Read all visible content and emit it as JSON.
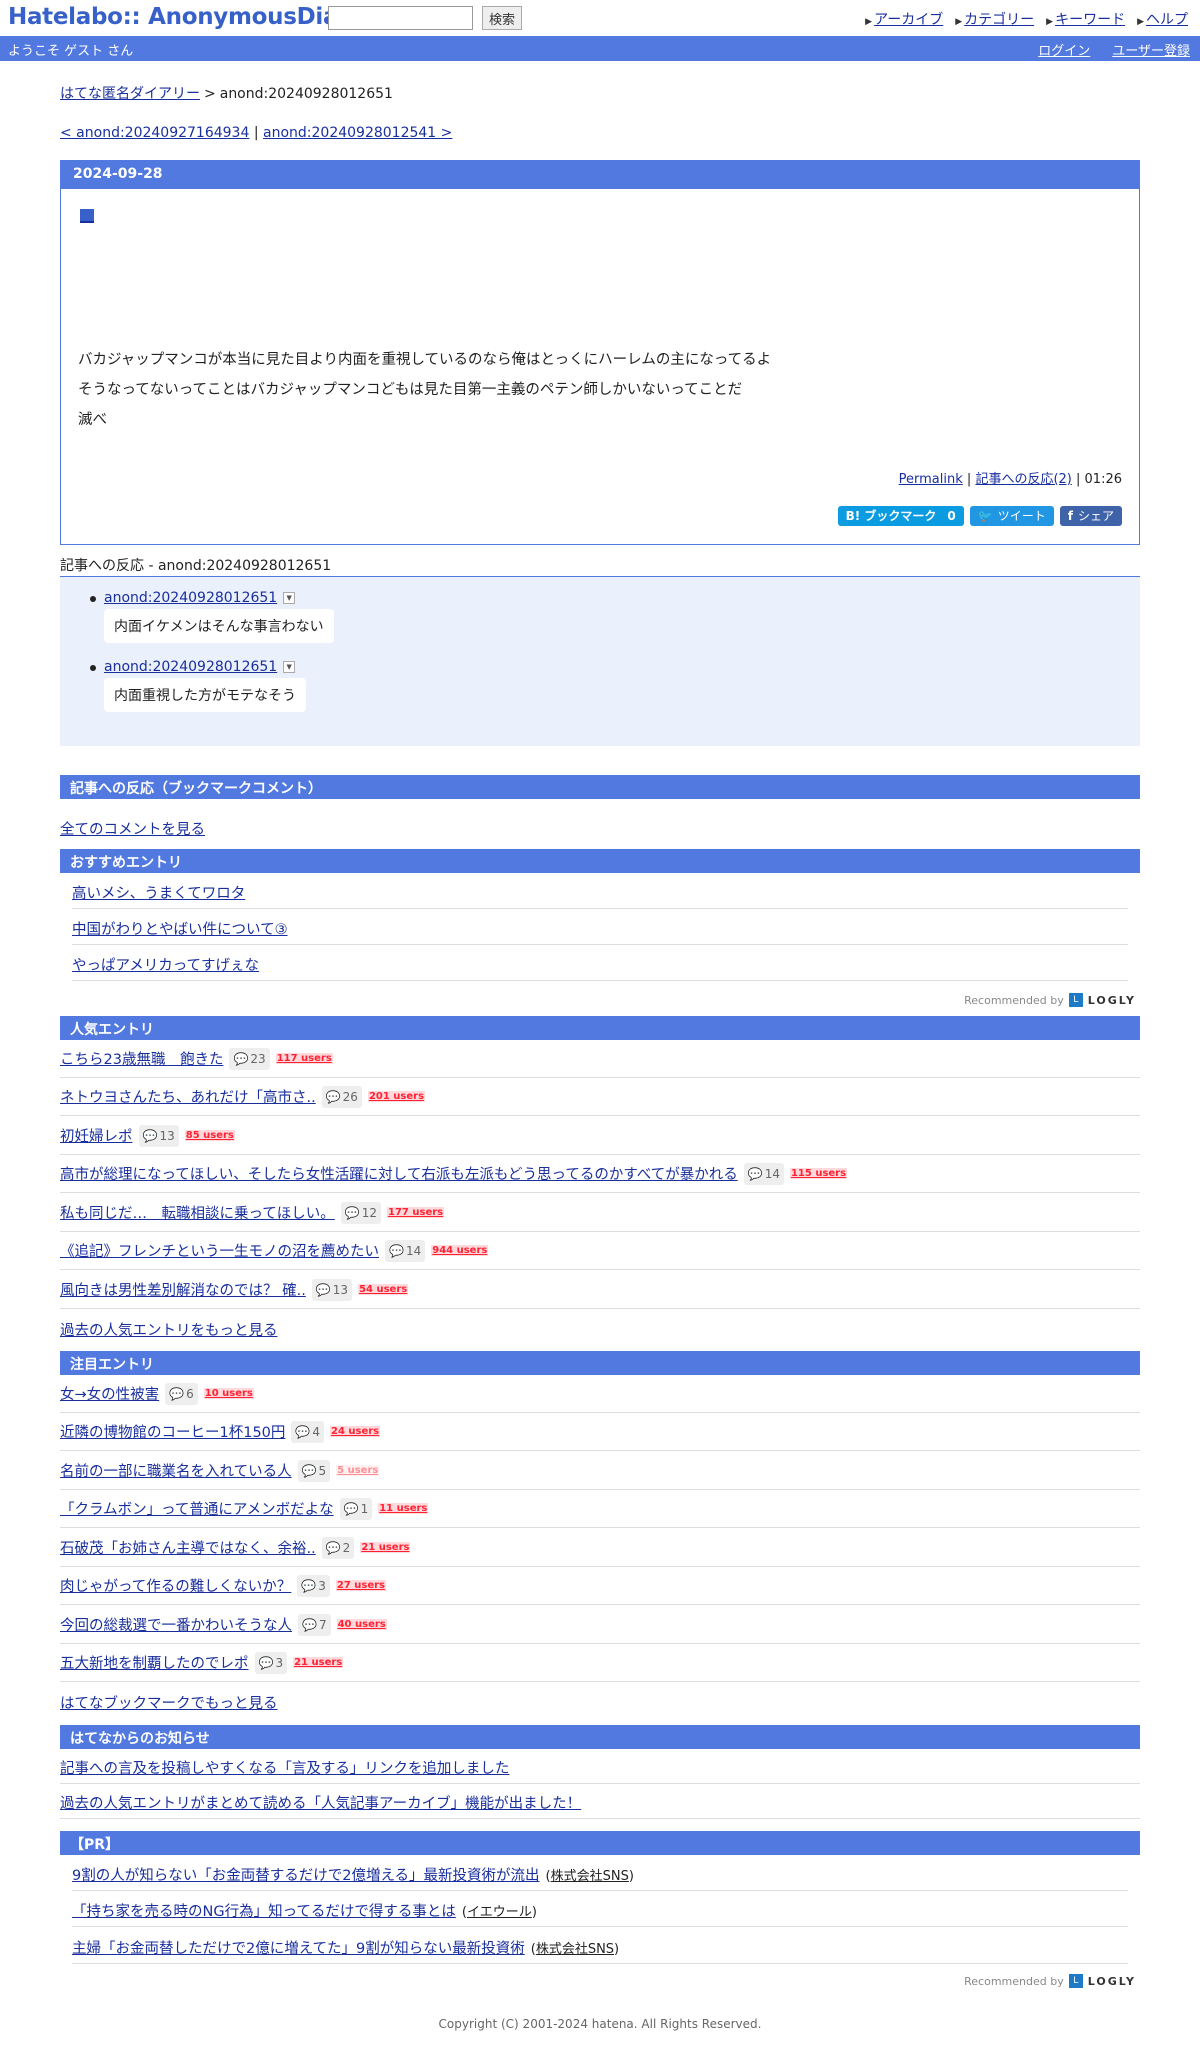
{
  "header": {
    "logo": "Hatelabo:: AnonymousDiary",
    "search_button": "検索",
    "search_value": "",
    "nav": [
      "アーカイブ",
      "カテゴリー",
      "キーワード",
      "ヘルプ"
    ]
  },
  "welcome": {
    "greeting": "ようこそ ゲスト さん",
    "login": "ログイン",
    "register": "ユーザー登録"
  },
  "breadcrumb": {
    "root": "はてな匿名ダイアリー",
    "current": "anond:20240928012651"
  },
  "pager": {
    "prev": "< anond:20240927164934",
    "sep": "|",
    "next": "anond:20240928012541 >"
  },
  "diary": {
    "date": "2024-09-28",
    "marker": "■",
    "lines": [
      "バカジャップマンコが本当に見た目より内面を重視しているのなら俺はとっくにハーレムの主になってるよ",
      "そうなってないってことはバカジャップマンコどもは見た目第一主義のペテン師しかいないってことだ",
      "滅べ"
    ],
    "permalink": "Permalink",
    "reactions_link": "記事への反応(2)",
    "time": "01:26",
    "bookmark_label": "B! ブックマーク",
    "bookmark_count": "0",
    "tweet_label": "ツイート",
    "share_label": "シェア"
  },
  "reactions": {
    "title": "記事への反応 - anond:20240928012651",
    "items": [
      {
        "id": "anond:20240928012651",
        "text": "内面イケメンはそんな事言わない"
      },
      {
        "id": "anond:20240928012651",
        "text": "内面重視した方がモテなそう"
      }
    ]
  },
  "bookmark_comments": {
    "heading": "記事への反応（ブックマークコメント）",
    "all_link": "全てのコメントを見る"
  },
  "recommended": {
    "heading": "おすすめエントリ",
    "items": [
      "高いメシ、うまくてワロタ",
      "中国がわりとやばい件について③",
      "やっぱアメリカってすげぇな"
    ],
    "recommended_by": "Recommended by",
    "logly": "LOGLY"
  },
  "popular": {
    "heading": "人気エントリ",
    "items": [
      {
        "title": "こちら23歳無職　飽きた",
        "comments": "23",
        "users": "117 users"
      },
      {
        "title": "ネトウヨさんたち、あれだけ「高市さ..",
        "comments": "26",
        "users": "201 users"
      },
      {
        "title": "初妊婦レポ",
        "comments": "13",
        "users": "85 users"
      },
      {
        "title": "高市が総理になってほしい、そしたら女性活躍に対して右派も左派もどう思ってるのかすべてが暴かれる",
        "comments": "14",
        "users": "115 users"
      },
      {
        "title": "私も同じだ…　転職相談に乗ってほしい。",
        "comments": "12",
        "users": "177 users"
      },
      {
        "title": "《追記》フレンチという一生モノの沼を薦めたい",
        "comments": "14",
        "users": "944 users"
      },
      {
        "title": "風向きは男性差別解消なのでは？ 確..",
        "comments": "13",
        "users": "54 users"
      }
    ],
    "more": "過去の人気エントリをもっと見る"
  },
  "hot": {
    "heading": "注目エントリ",
    "items": [
      {
        "title": "女→女の性被害",
        "comments": "6",
        "users": "10 users"
      },
      {
        "title": "近隣の博物館のコーヒー1杯150円",
        "comments": "4",
        "users": "24 users"
      },
      {
        "title": "名前の一部に職業名を入れている人",
        "comments": "5",
        "users": "5 users"
      },
      {
        "title": "「クラムボン」って普通にアメンボだよな",
        "comments": "1",
        "users": "11 users"
      },
      {
        "title": "石破茂「お姉さん主導ではなく、余裕..",
        "comments": "2",
        "users": "21 users"
      },
      {
        "title": "肉じゃがって作るの難しくないか？",
        "comments": "3",
        "users": "27 users"
      },
      {
        "title": "今回の総裁選で一番かわいそうな人",
        "comments": "7",
        "users": "40 users"
      },
      {
        "title": "五大新地を制覇したのでレポ",
        "comments": "3",
        "users": "21 users"
      }
    ],
    "more": "はてなブックマークでもっと見る"
  },
  "news": {
    "heading": "はてなからのお知らせ",
    "items": [
      "記事への言及を投稿しやすくなる「言及する」リンクを追加しました",
      "過去の人気エントリがまとめて読める「人気記事アーカイブ」機能が出ました！"
    ]
  },
  "pr": {
    "heading": "【PR】",
    "items": [
      {
        "title": "9割の人が知らない「お金両替するだけで2億増える」最新投資術が流出",
        "sponsor": "株式会社SNS"
      },
      {
        "title": "「持ち家を売る時のNG行為」知ってるだけで得する事とは",
        "sponsor": "イエウール"
      },
      {
        "title": "主婦「お金両替しただけで2億に増えてた」9割が知らない最新投資術",
        "sponsor": "株式会社SNS"
      }
    ]
  },
  "footer": {
    "copyright": "Copyright (C) 2001-2024 hatena. All Rights Reserved."
  }
}
